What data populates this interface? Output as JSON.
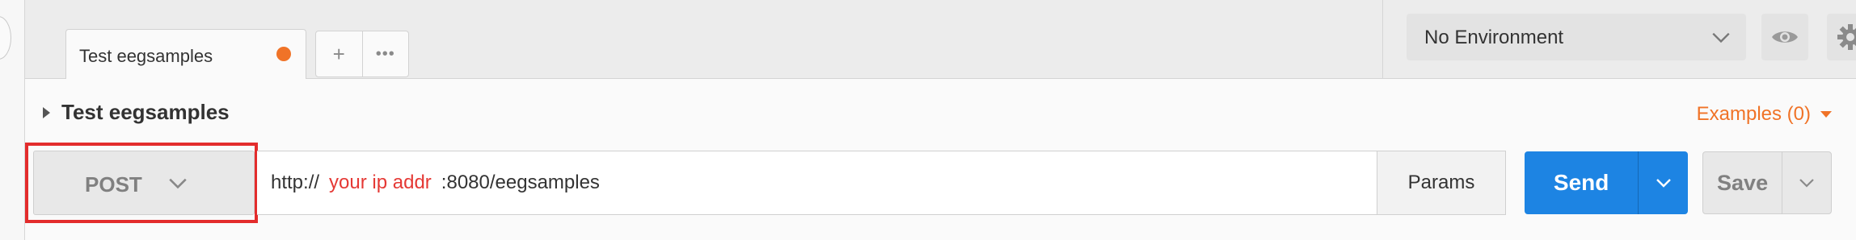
{
  "tabs": {
    "active": {
      "title": "Test eegsamples",
      "unsaved_color": "#f07327"
    },
    "new_tab_symbol": "+",
    "more_symbol": "•••"
  },
  "environment": {
    "selected": "No Environment",
    "icons": [
      "chevron-down-icon",
      "eye-icon",
      "gear-icon"
    ]
  },
  "request": {
    "name": "Test eegsamples",
    "examples_label": "Examples (0)",
    "method": "POST",
    "url": {
      "scheme": "http://",
      "host_placeholder": "your ip addr",
      "path": ":8080/eegsamples"
    },
    "params_label": "Params",
    "send_label": "Send",
    "save_label": "Save"
  },
  "colors": {
    "accent_orange": "#f07327",
    "send_blue": "#1d84e3",
    "highlight_red": "#e32c2c",
    "url_host_red": "#e53935"
  }
}
